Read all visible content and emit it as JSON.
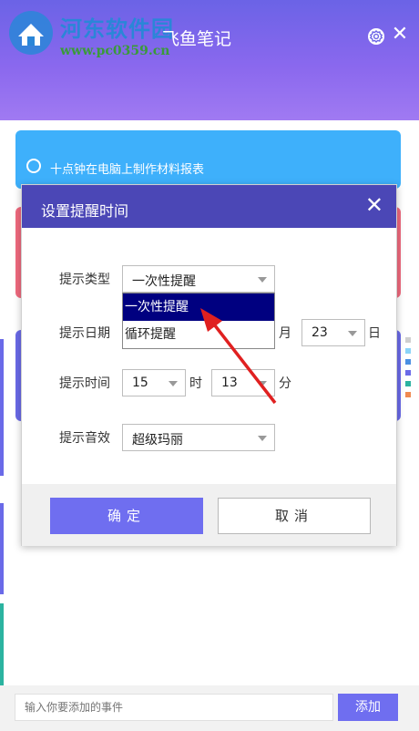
{
  "app": {
    "title": "飞鱼笔记"
  },
  "watermark": {
    "name": "河东软件园",
    "url": "www.pc0359.cn"
  },
  "task_card": {
    "text": "十点钟在电脑上制作材料报表"
  },
  "dialog": {
    "title": "设置提醒时间",
    "type_label": "提示类型",
    "type_value": "一次性提醒",
    "type_options": [
      "一次性提醒",
      "循环提醒"
    ],
    "date_label": "提示日期",
    "month_unit": "月",
    "day_value": "23",
    "day_unit": "日",
    "time_label": "提示时间",
    "hour_value": "15",
    "hour_unit": "时",
    "minute_value": "13",
    "minute_unit": "分",
    "sound_label": "提示音效",
    "sound_value": "超级玛丽",
    "ok_label": "确定",
    "cancel_label": "取消"
  },
  "bottom": {
    "input_placeholder": "输入你要添加的事件",
    "add_label": "添加"
  },
  "colors": {
    "accent": "#6f6ef0",
    "dialog_header": "#4b47b6",
    "card_blue": "#3eb0fb",
    "card_pink": "#f06a7e",
    "card_indigo": "#6a6ae8",
    "selection": "#000080",
    "annotation_arrow": "#e02020"
  }
}
